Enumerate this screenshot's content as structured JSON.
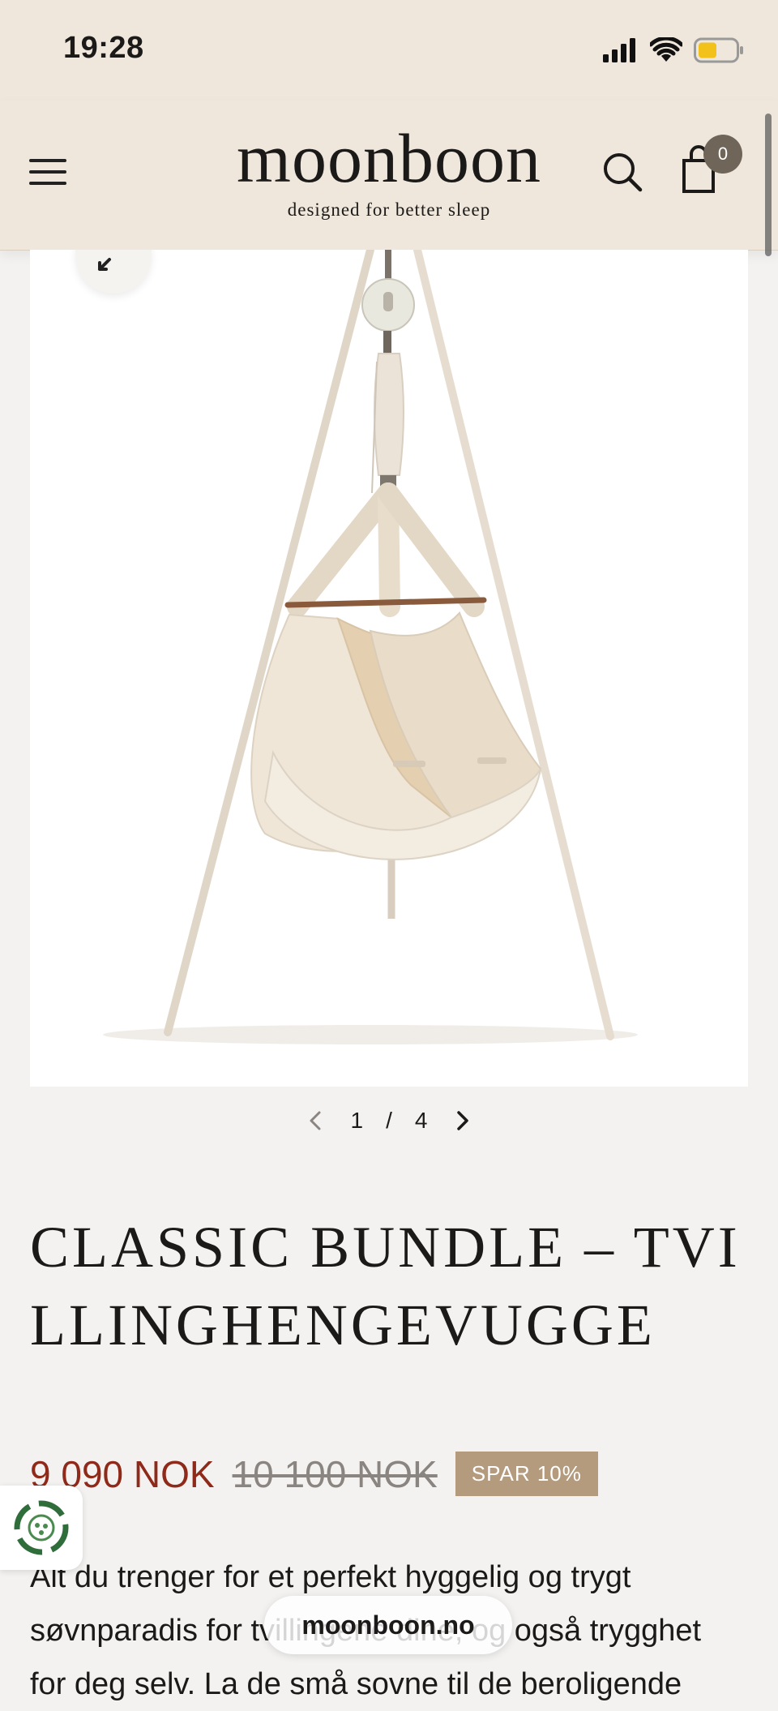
{
  "status_bar": {
    "time": "19:28"
  },
  "header": {
    "logo": "moonboon",
    "tagline": "designed for better sleep",
    "cart_count": "0"
  },
  "gallery": {
    "current": "1",
    "separator": "/",
    "total": "4"
  },
  "product": {
    "title": "CLASSIC BUNDLE – TVILLINGHENGEVUGGE",
    "price_sale": "9 090 NOK",
    "price_original": "10 100 NOK",
    "discount_badge": "SPAR 10%",
    "description": "Alt du trenger for et perfekt hyggelig og trygt søvnparadis for tvillingene dine, og også trygghet for deg selv. La de små sovne til de beroligende"
  },
  "browser": {
    "url": "moonboon.no"
  },
  "colors": {
    "header_bg": "#efe7dc",
    "sale_price": "#8f2a1a",
    "badge_bg": "#b49b7e"
  }
}
